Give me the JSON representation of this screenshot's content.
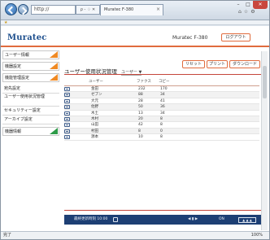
{
  "browser": {
    "address": "http://",
    "address_controls": "ρ - ♢ ✕",
    "tab_title": "Muratec F-380",
    "favorites": "★"
  },
  "header": {
    "logo": "Muratec",
    "model": "Muratec F-380",
    "logout_label": "ログアウト"
  },
  "sidebar": {
    "items": [
      {
        "label": "ユーザー情報",
        "style": "boxed-orange"
      },
      {
        "label": "機器設定",
        "style": "boxed-orange"
      },
      {
        "label": "機能管理設定",
        "style": "boxed-orange"
      },
      {
        "label": "宛先設定",
        "style": "plain"
      },
      {
        "label": "ユーザー使用状況管理",
        "style": "plain-tall"
      },
      {
        "label": "セキュリティー設定",
        "style": "plain"
      },
      {
        "label": "アーカイブ設定",
        "style": "plain"
      },
      {
        "label": "機器情報",
        "style": "boxed-green"
      }
    ]
  },
  "main": {
    "title": "ユーザー使用状況管理",
    "dropdown_label": "ユーザー ▼",
    "buttons": {
      "reset": "リセット",
      "print": "プリント",
      "download": "ダウンロード"
    },
    "columns": {
      "user": "ユーザー",
      "fax": "ファクス",
      "copy": "コピー"
    },
    "rows": [
      {
        "user": "金田",
        "fax": "232",
        "copy": "170"
      },
      {
        "user": "ゼブン",
        "fax": "88",
        "copy": "34"
      },
      {
        "user": "大元",
        "fax": "28",
        "copy": "41"
      },
      {
        "user": "佐野",
        "fax": "50",
        "copy": "36"
      },
      {
        "user": "木土",
        "fax": "13",
        "copy": "34"
      },
      {
        "user": "木村",
        "fax": "20",
        "copy": "8"
      },
      {
        "user": "山田",
        "fax": "42",
        "copy": "8"
      },
      {
        "user": "村田",
        "fax": "8",
        "copy": "0"
      },
      {
        "user": "源本",
        "fax": "10",
        "copy": "8"
      }
    ]
  },
  "footer": {
    "timestamp": "最終更新時刻 10:00",
    "pager": "◀ ▮ ▶",
    "setting": "ON",
    "view": "▲ ▲ ▲"
  },
  "status": {
    "left": "完了",
    "zoom": "100%"
  },
  "colors": {
    "accent": "#e06b3d",
    "rule": "#c5463b",
    "footer_bg": "#1d3f74",
    "logo": "#1b4d8c"
  }
}
